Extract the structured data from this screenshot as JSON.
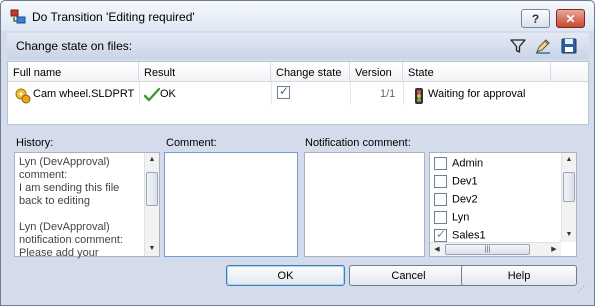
{
  "window": {
    "title": "Do Transition 'Editing required'",
    "help_label": "?",
    "close_label": "✕"
  },
  "header": {
    "label": "Change state on files:"
  },
  "grid": {
    "columns": [
      "Full name",
      "Result",
      "Change state",
      "Version",
      "State"
    ],
    "rows": [
      {
        "full_name": "Cam wheel.SLDPRT",
        "result": "OK",
        "change_state": true,
        "version": "1/1",
        "state": "Waiting for approval"
      }
    ]
  },
  "history": {
    "label": "History:",
    "text": "Lyn (DevApproval)\ncomment:\nI am sending this file\nback to editing\n\nLyn (DevApproval)\nnotification comment:\nPlease add your"
  },
  "comment": {
    "label": "Comment:",
    "value": ""
  },
  "notification": {
    "label": "Notification comment:",
    "value": ""
  },
  "users": [
    {
      "name": "Admin",
      "checked": false
    },
    {
      "name": "Dev1",
      "checked": false
    },
    {
      "name": "Dev2",
      "checked": false
    },
    {
      "name": "Lyn",
      "checked": false
    },
    {
      "name": "Sales1",
      "checked": true
    }
  ],
  "buttons": {
    "ok": "OK",
    "cancel": "Cancel",
    "help": "Help"
  }
}
